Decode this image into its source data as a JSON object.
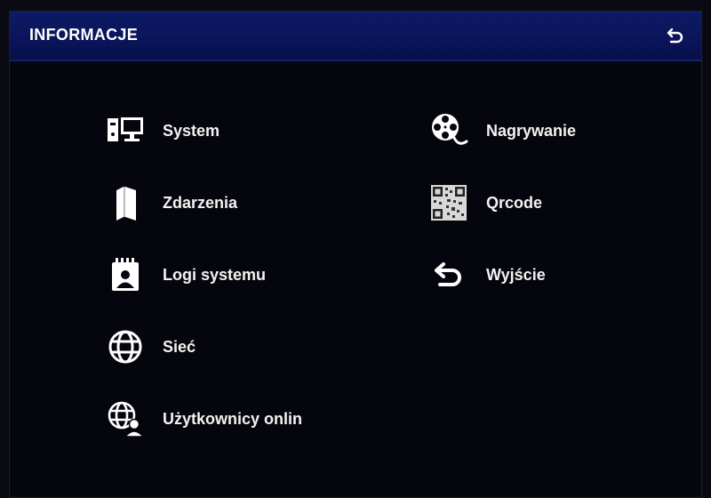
{
  "header": {
    "title": "INFORMACJE",
    "back_icon": "return-arrow-icon"
  },
  "menu": {
    "left": [
      {
        "label": "System",
        "icon": "computer-icon"
      },
      {
        "label": "Zdarzenia",
        "icon": "book-icon"
      },
      {
        "label": "Logi systemu",
        "icon": "log-notebook-icon"
      },
      {
        "label": "Sieć",
        "icon": "globe-icon"
      },
      {
        "label": "Użytkownicy onlin",
        "icon": "globe-user-icon"
      }
    ],
    "right": [
      {
        "label": "Nagrywanie",
        "icon": "film-reel-icon"
      },
      {
        "label": "Qrcode",
        "icon": "qrcode-icon"
      },
      {
        "label": "Wyjście",
        "icon": "return-arrow-icon"
      }
    ]
  },
  "colors": {
    "header_bg": "#0a145a",
    "background": "#05060d",
    "text": "#f2f2f2"
  }
}
